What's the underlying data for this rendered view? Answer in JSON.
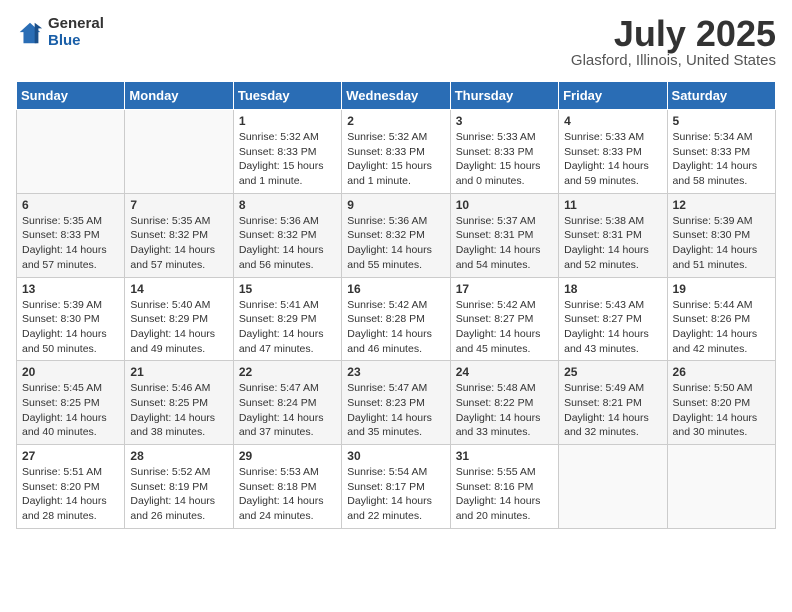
{
  "logo": {
    "general": "General",
    "blue": "Blue"
  },
  "header": {
    "month": "July 2025",
    "location": "Glasford, Illinois, United States"
  },
  "weekdays": [
    "Sunday",
    "Monday",
    "Tuesday",
    "Wednesday",
    "Thursday",
    "Friday",
    "Saturday"
  ],
  "weeks": [
    [
      {
        "day": "",
        "content": ""
      },
      {
        "day": "",
        "content": ""
      },
      {
        "day": "1",
        "content": "Sunrise: 5:32 AM\nSunset: 8:33 PM\nDaylight: 15 hours and 1 minute."
      },
      {
        "day": "2",
        "content": "Sunrise: 5:32 AM\nSunset: 8:33 PM\nDaylight: 15 hours and 1 minute."
      },
      {
        "day": "3",
        "content": "Sunrise: 5:33 AM\nSunset: 8:33 PM\nDaylight: 15 hours and 0 minutes."
      },
      {
        "day": "4",
        "content": "Sunrise: 5:33 AM\nSunset: 8:33 PM\nDaylight: 14 hours and 59 minutes."
      },
      {
        "day": "5",
        "content": "Sunrise: 5:34 AM\nSunset: 8:33 PM\nDaylight: 14 hours and 58 minutes."
      }
    ],
    [
      {
        "day": "6",
        "content": "Sunrise: 5:35 AM\nSunset: 8:33 PM\nDaylight: 14 hours and 57 minutes."
      },
      {
        "day": "7",
        "content": "Sunrise: 5:35 AM\nSunset: 8:32 PM\nDaylight: 14 hours and 57 minutes."
      },
      {
        "day": "8",
        "content": "Sunrise: 5:36 AM\nSunset: 8:32 PM\nDaylight: 14 hours and 56 minutes."
      },
      {
        "day": "9",
        "content": "Sunrise: 5:36 AM\nSunset: 8:32 PM\nDaylight: 14 hours and 55 minutes."
      },
      {
        "day": "10",
        "content": "Sunrise: 5:37 AM\nSunset: 8:31 PM\nDaylight: 14 hours and 54 minutes."
      },
      {
        "day": "11",
        "content": "Sunrise: 5:38 AM\nSunset: 8:31 PM\nDaylight: 14 hours and 52 minutes."
      },
      {
        "day": "12",
        "content": "Sunrise: 5:39 AM\nSunset: 8:30 PM\nDaylight: 14 hours and 51 minutes."
      }
    ],
    [
      {
        "day": "13",
        "content": "Sunrise: 5:39 AM\nSunset: 8:30 PM\nDaylight: 14 hours and 50 minutes."
      },
      {
        "day": "14",
        "content": "Sunrise: 5:40 AM\nSunset: 8:29 PM\nDaylight: 14 hours and 49 minutes."
      },
      {
        "day": "15",
        "content": "Sunrise: 5:41 AM\nSunset: 8:29 PM\nDaylight: 14 hours and 47 minutes."
      },
      {
        "day": "16",
        "content": "Sunrise: 5:42 AM\nSunset: 8:28 PM\nDaylight: 14 hours and 46 minutes."
      },
      {
        "day": "17",
        "content": "Sunrise: 5:42 AM\nSunset: 8:27 PM\nDaylight: 14 hours and 45 minutes."
      },
      {
        "day": "18",
        "content": "Sunrise: 5:43 AM\nSunset: 8:27 PM\nDaylight: 14 hours and 43 minutes."
      },
      {
        "day": "19",
        "content": "Sunrise: 5:44 AM\nSunset: 8:26 PM\nDaylight: 14 hours and 42 minutes."
      }
    ],
    [
      {
        "day": "20",
        "content": "Sunrise: 5:45 AM\nSunset: 8:25 PM\nDaylight: 14 hours and 40 minutes."
      },
      {
        "day": "21",
        "content": "Sunrise: 5:46 AM\nSunset: 8:25 PM\nDaylight: 14 hours and 38 minutes."
      },
      {
        "day": "22",
        "content": "Sunrise: 5:47 AM\nSunset: 8:24 PM\nDaylight: 14 hours and 37 minutes."
      },
      {
        "day": "23",
        "content": "Sunrise: 5:47 AM\nSunset: 8:23 PM\nDaylight: 14 hours and 35 minutes."
      },
      {
        "day": "24",
        "content": "Sunrise: 5:48 AM\nSunset: 8:22 PM\nDaylight: 14 hours and 33 minutes."
      },
      {
        "day": "25",
        "content": "Sunrise: 5:49 AM\nSunset: 8:21 PM\nDaylight: 14 hours and 32 minutes."
      },
      {
        "day": "26",
        "content": "Sunrise: 5:50 AM\nSunset: 8:20 PM\nDaylight: 14 hours and 30 minutes."
      }
    ],
    [
      {
        "day": "27",
        "content": "Sunrise: 5:51 AM\nSunset: 8:20 PM\nDaylight: 14 hours and 28 minutes."
      },
      {
        "day": "28",
        "content": "Sunrise: 5:52 AM\nSunset: 8:19 PM\nDaylight: 14 hours and 26 minutes."
      },
      {
        "day": "29",
        "content": "Sunrise: 5:53 AM\nSunset: 8:18 PM\nDaylight: 14 hours and 24 minutes."
      },
      {
        "day": "30",
        "content": "Sunrise: 5:54 AM\nSunset: 8:17 PM\nDaylight: 14 hours and 22 minutes."
      },
      {
        "day": "31",
        "content": "Sunrise: 5:55 AM\nSunset: 8:16 PM\nDaylight: 14 hours and 20 minutes."
      },
      {
        "day": "",
        "content": ""
      },
      {
        "day": "",
        "content": ""
      }
    ]
  ]
}
